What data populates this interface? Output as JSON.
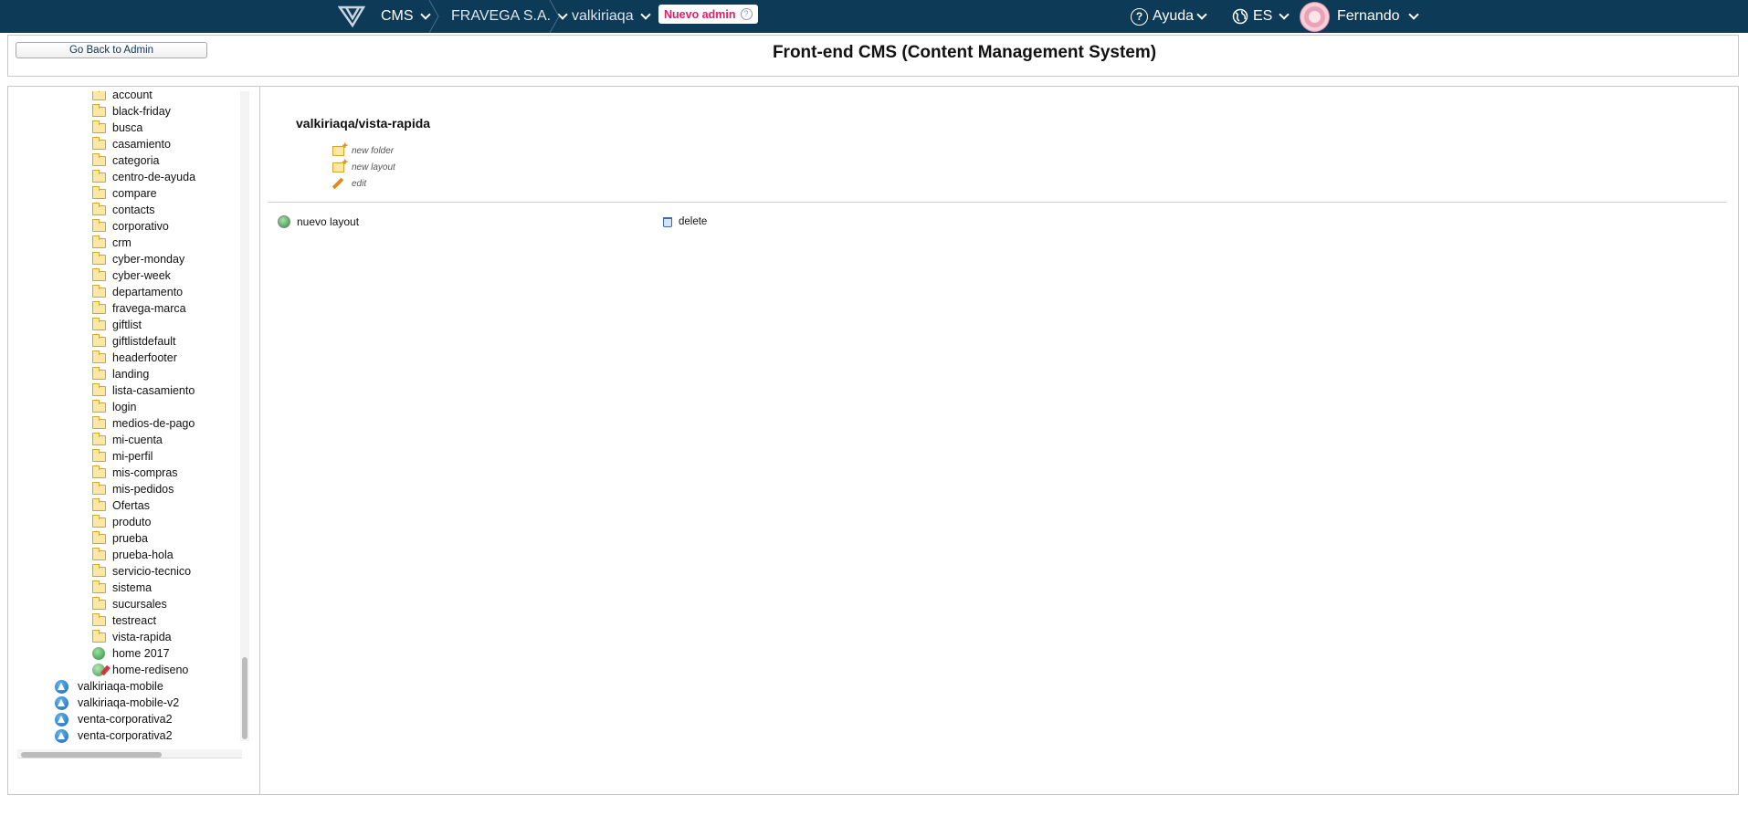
{
  "topbar": {
    "cms_label": "CMS",
    "company_label": "FRAVEGA S.A.",
    "store_label": "valkiriaqa",
    "badge_label": "Nuevo admin",
    "help_label": "Ayuda",
    "lang_label": "ES",
    "user_label": "Fernando"
  },
  "header": {
    "back_button": "Go Back to Admin",
    "title": "Front-end CMS (Content Management System)"
  },
  "tree": {
    "folders": [
      "account",
      "black-friday",
      "busca",
      "casamiento",
      "categoria",
      "centro-de-ayuda",
      "compare",
      "contacts",
      "corporativo",
      "crm",
      "cyber-monday",
      "cyber-week",
      "departamento",
      "fravega-marca",
      "giftlist",
      "giftlistdefault",
      "headerfooter",
      "landing",
      "lista-casamiento",
      "login",
      "medios-de-pago",
      "mi-cuenta",
      "mi-perfil",
      "mis-compras",
      "mis-pedidos",
      "Ofertas",
      "produto",
      "prueba",
      "prueba-hola",
      "servicio-tecnico",
      "sistema",
      "sucursales",
      "testreact",
      "vista-rapida"
    ],
    "layouts": [
      "home 2017",
      "home-rediseno"
    ],
    "sites": [
      "valkiriaqa-mobile",
      "valkiriaqa-mobile-v2",
      "venta-corporativa2",
      "venta-corporativa2"
    ]
  },
  "content": {
    "path": "valkiriaqa/vista-rapida",
    "actions": {
      "new_folder": "new folder",
      "new_layout": "new layout",
      "edit": "edit"
    },
    "rows": [
      {
        "name": "nuevo layout",
        "delete": "delete"
      }
    ]
  }
}
